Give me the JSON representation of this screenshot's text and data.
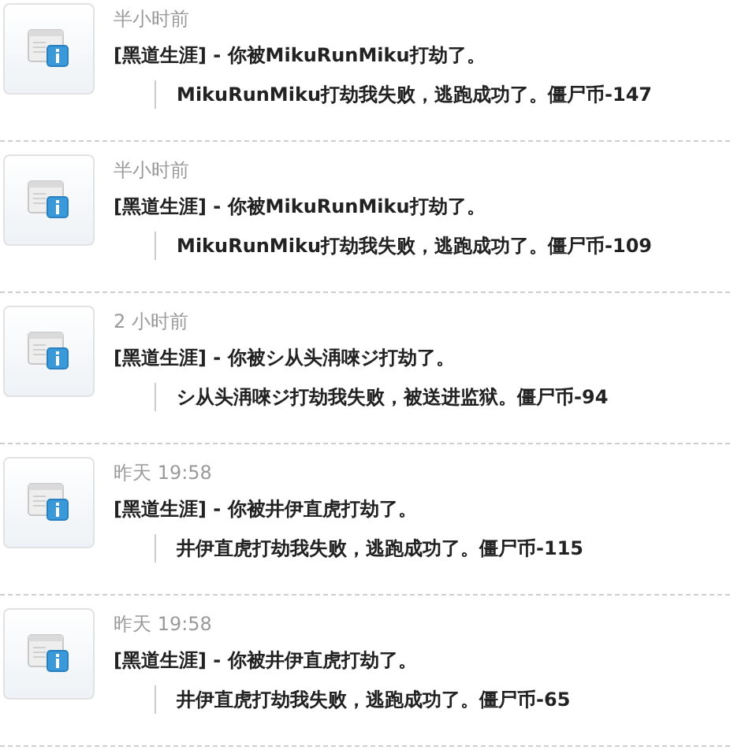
{
  "entries": [
    {
      "time": "半小时前",
      "title": "[黑道生涯] - 你被MikuRunMiku打劫了。",
      "detail": "MikuRunMiku打劫我失败，逃跑成功了。僵尸币-147"
    },
    {
      "time": "半小时前",
      "title": "[黑道生涯] - 你被MikuRunMiku打劫了。",
      "detail": "MikuRunMiku打劫我失败，逃跑成功了。僵尸币-109"
    },
    {
      "time": "2 小时前",
      "title": "[黑道生涯] - 你被シ从头洅唻ジ打劫了。",
      "detail": "シ从头洅唻ジ打劫我失败，被送进监狱。僵尸币-94"
    },
    {
      "time": "昨天 19:58",
      "title": "[黑道生涯] - 你被井伊直虎打劫了。",
      "detail": "井伊直虎打劫我失败，逃跑成功了。僵尸币-115"
    },
    {
      "time": "昨天 19:58",
      "title": "[黑道生涯] - 你被井伊直虎打劫了。",
      "detail": "井伊直虎打劫我失败，逃跑成功了。僵尸币-65"
    }
  ]
}
